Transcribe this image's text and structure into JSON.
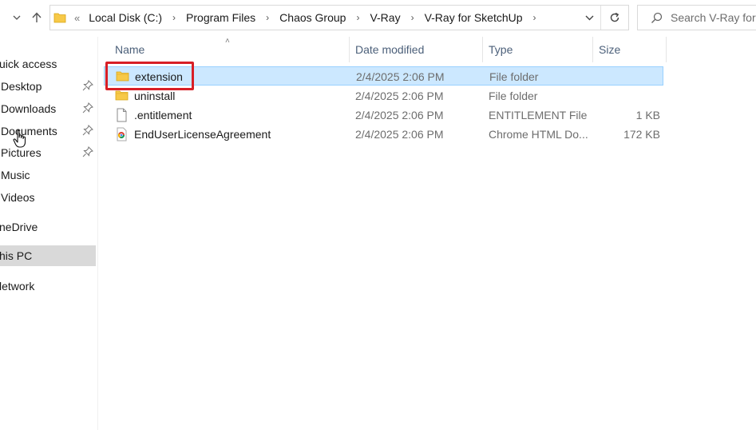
{
  "address_bar": {
    "lead": "«",
    "crumbs": [
      "Local Disk (C:)",
      "Program Files",
      "Chaos Group",
      "V-Ray",
      "V-Ray for SketchUp"
    ]
  },
  "search": {
    "placeholder": "Search V-Ray for SketchUp"
  },
  "sidebar": {
    "items": [
      {
        "label": "uick access"
      },
      {
        "label": "Desktop",
        "pinned": true
      },
      {
        "label": "Downloads",
        "pinned": true
      },
      {
        "label": "Documents",
        "pinned": true
      },
      {
        "label": "Pictures",
        "pinned": true
      },
      {
        "label": "Music"
      },
      {
        "label": "Videos"
      },
      {
        "label": "neDrive"
      },
      {
        "label": "his PC",
        "selected": true
      },
      {
        "label": "letwork"
      }
    ]
  },
  "columns": {
    "name": "Name",
    "date": "Date modified",
    "type": "Type",
    "size": "Size"
  },
  "files": [
    {
      "name": "extension",
      "date": "2/4/2025 2:06 PM",
      "type": "File folder",
      "size": "",
      "icon": "folder-icon",
      "selected": true
    },
    {
      "name": "uninstall",
      "date": "2/4/2025 2:06 PM",
      "type": "File folder",
      "size": "",
      "icon": "folder-icon"
    },
    {
      "name": ".entitlement",
      "date": "2/4/2025 2:06 PM",
      "type": "ENTITLEMENT File",
      "size": "1 KB",
      "icon": "file-icon"
    },
    {
      "name": "EndUserLicenseAgreement",
      "date": "2/4/2025 2:06 PM",
      "type": "Chrome HTML Do...",
      "size": "172 KB",
      "icon": "chrome-icon"
    }
  ],
  "colors": {
    "selection_fill": "#cce8ff",
    "selection_border": "#99d1ff",
    "highlight_box": "#d81f26",
    "folder_yellow": "#f7c948",
    "header_text": "#4c607a"
  }
}
